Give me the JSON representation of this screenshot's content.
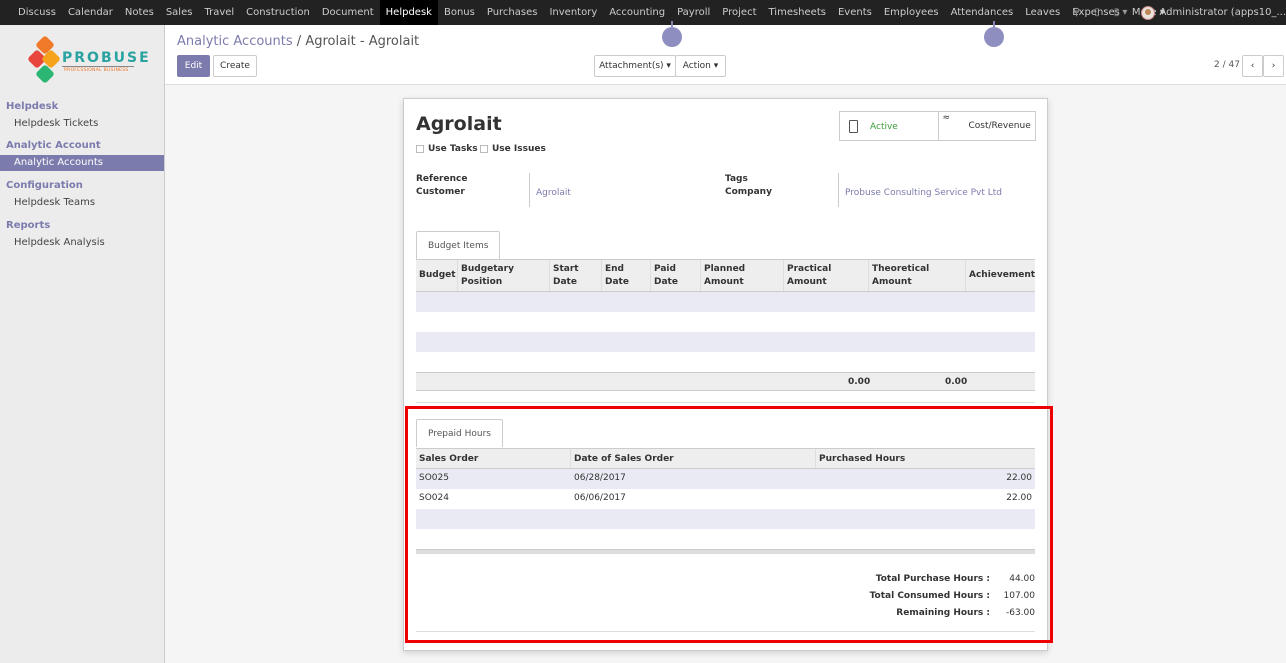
{
  "topbar": {
    "menu": [
      "Discuss",
      "Calendar",
      "Notes",
      "Sales",
      "Travel",
      "Construction",
      "Document",
      "Helpdesk",
      "Bonus",
      "Purchases",
      "Inventory",
      "Accounting",
      "Payroll",
      "Project",
      "Timesheets",
      "Events",
      "Employees",
      "Attendances",
      "Leaves",
      "Expenses",
      "More ▾"
    ],
    "active": "Helpdesk",
    "user": "Administrator (apps10_..."
  },
  "sidebar": {
    "logo": {
      "brand": "PROBUSE",
      "tagline": "PROFESSIONAL BUSINESS"
    },
    "sections": [
      {
        "title": "Helpdesk",
        "items": [
          "Helpdesk Tickets"
        ]
      },
      {
        "title": "Analytic Account",
        "items": [
          "Analytic Accounts"
        ]
      },
      {
        "title": "Configuration",
        "items": [
          "Helpdesk Teams"
        ]
      },
      {
        "title": "Reports",
        "items": [
          "Helpdesk Analysis"
        ]
      }
    ],
    "active_item": "Analytic Accounts"
  },
  "control": {
    "breadcrumb_link": "Analytic Accounts",
    "breadcrumb_sep": " / ",
    "breadcrumb_current": "Agrolait - Agrolait",
    "edit_label": "Edit",
    "create_label": "Create",
    "attachments_label": "Attachment(s) ▾",
    "action_label": "Action ▾",
    "pager": "2 / 47"
  },
  "form": {
    "title": "Agrolait",
    "use_tasks": "Use Tasks",
    "use_issues": "Use Issues",
    "stat_active": "Active",
    "stat_cost": "Cost/Revenue",
    "reference_label": "Reference",
    "customer_label": "Customer",
    "customer_value": "Agrolait",
    "tags_label": "Tags",
    "company_label": "Company",
    "company_value": "Probuse Consulting Service Pvt Ltd"
  },
  "budget": {
    "tab": "Budget Items",
    "columns": [
      "Budget",
      "Budgetary Position",
      "Start Date",
      "End Date",
      "Paid Date",
      "Planned Amount",
      "Practical Amount",
      "Theoretical Amount",
      "Achievement"
    ],
    "total_practical": "0.00",
    "total_theoretical": "0.00"
  },
  "prepaid": {
    "tab": "Prepaid Hours",
    "columns": [
      "Sales Order",
      "Date of Sales Order",
      "Purchased Hours"
    ],
    "rows": [
      {
        "order": "SO025",
        "date": "06/28/2017",
        "hours": "22.00"
      },
      {
        "order": "SO024",
        "date": "06/06/2017",
        "hours": "22.00"
      }
    ],
    "totals": [
      {
        "label": "Total Purchase Hours :",
        "value": "44.00"
      },
      {
        "label": "Total Consumed Hours :",
        "value": "107.00"
      },
      {
        "label": "Remaining Hours :",
        "value": "-63.00"
      }
    ]
  },
  "colors": {
    "accent": "#7c7bad",
    "topbar": "#222222",
    "highlight": "#e00000",
    "active_green": "#3c9b3c"
  }
}
